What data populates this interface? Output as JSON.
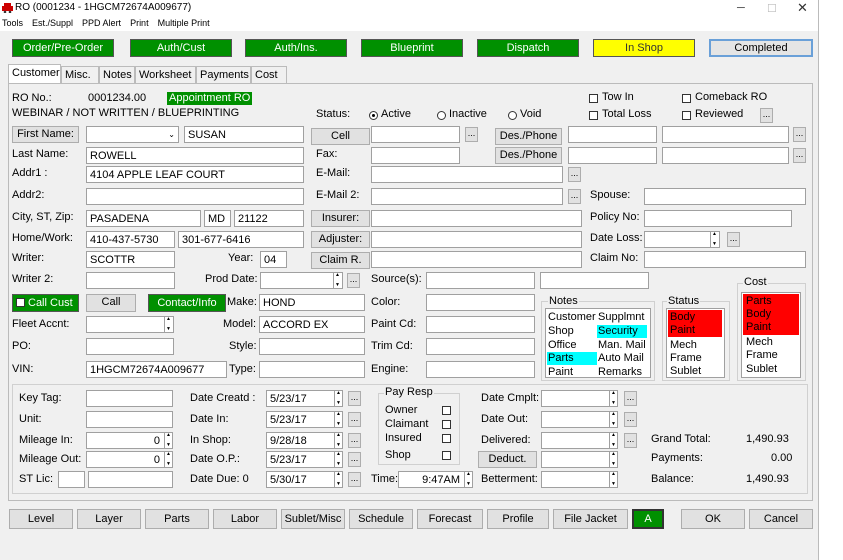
{
  "window": {
    "title": "RO (0001234 - 1HGCM72674A009677)"
  },
  "menu": [
    "Tools",
    "Est./Suppl",
    "PPD Alert",
    "Print",
    "Multiple Print"
  ],
  "top_buttons": [
    "Order/Pre-Order",
    "Auth/Cust",
    "Auth/Ins.",
    "Blueprint",
    "Dispatch",
    "In Shop",
    "Completed"
  ],
  "tabs": [
    "Customer",
    "Misc.",
    "Notes",
    "Worksheet",
    "Payments",
    "Cost"
  ],
  "ro": {
    "label": "RO No.:",
    "number": "0001234.00",
    "appointment": "Appointment RO",
    "subtitle": "WEBINAR / NOT WRITTEN / BLUEPRINTING"
  },
  "status": {
    "label": "Status:",
    "options": [
      "Active",
      "Inactive",
      "Void"
    ]
  },
  "flags": [
    "Tow In",
    "Total Loss",
    "Comeback RO",
    "Reviewed"
  ],
  "customer": {
    "first_name_btn": "First Name:",
    "first_name": "SUSAN",
    "last_name_label": "Last Name:",
    "last_name": "ROWELL",
    "addr1_label": "Addr1 :",
    "addr1": "4104 APPLE LEAF COURT",
    "addr2_label": "Addr2:",
    "addr2": "",
    "city_label": "City, ST, Zip:",
    "city": "PASADENA",
    "state": "MD",
    "zip": "21122",
    "home_work_label": "Home/Work:",
    "home": "410-437-5730",
    "work": "301-677-6416",
    "writer_label": "Writer:",
    "writer": "SCOTTR",
    "year_label": "Year:",
    "year": "04",
    "writer2_label": "Writer 2:",
    "prod_date_label": "Prod Date:"
  },
  "contact": {
    "cell_btn": "Cell",
    "fax_label": "Fax:",
    "email_label": "E-Mail:",
    "email2_label": "E-Mail 2:",
    "desphone_btn": "Des./Phone",
    "insurer_btn": "Insurer:",
    "adjuster_btn": "Adjuster:",
    "claim_btn": "Claim R.",
    "spouse_label": "Spouse:",
    "policy_label": "Policy No:",
    "date_loss_label": "Date Loss:",
    "claim_no_label": "Claim No:",
    "sources_label": "Source(s):"
  },
  "vehicle": {
    "call_cust": "Call Cust",
    "call": "Call",
    "contact_info": "Contact/Info",
    "make_label": "Make:",
    "make": "HOND",
    "model_label": "Model:",
    "model": "ACCORD EX",
    "style_label": "Style:",
    "type_label": "Type:",
    "color_label": "Color:",
    "paint_label": "Paint Cd:",
    "trim_label": "Trim Cd:",
    "engine_label": "Engine:",
    "fleet_label": "Fleet Accnt:",
    "po_label": "PO:",
    "vin_label": "VIN:",
    "vin": "1HGCM72674A009677"
  },
  "notes": {
    "title": "Notes",
    "col1": [
      "Customer",
      "Shop",
      "Office",
      "Parts",
      "Paint"
    ],
    "col2": [
      "Supplmnt",
      "Security",
      "Man. Mail",
      "Auto Mail",
      "Remarks"
    ]
  },
  "status_list": {
    "title": "Status",
    "items": [
      "Body",
      "Paint",
      "Mech",
      "Frame",
      "Sublet"
    ]
  },
  "cost_list": {
    "title": "Cost",
    "items": [
      "Parts",
      "Body",
      "Paint",
      "Mech",
      "Frame",
      "Sublet"
    ]
  },
  "bottom": {
    "key_tag_label": "Key Tag:",
    "unit_label": "Unit:",
    "mileage_in_label": "Mileage In:",
    "mileage_in": "0",
    "mileage_out_label": "Mileage Out:",
    "mileage_out": "0",
    "st_lic_label": "ST Lic:",
    "date_created_label": "Date Creatd :",
    "date_created": "5/23/17",
    "date_in_label": "Date In:",
    "date_in": "5/23/17",
    "in_shop_label": "In Shop:",
    "in_shop": "9/28/18",
    "date_op_label": "Date O.P.:",
    "date_op": "5/23/17",
    "date_due_label": "Date Due: 0",
    "date_due": "5/30/17",
    "time_label": "Time:",
    "time": "9:47AM",
    "pay_resp_title": "Pay Resp",
    "pay_resp": [
      "Owner",
      "Claimant",
      "Insured",
      "Shop"
    ],
    "date_cmplt_label": "Date Cmplt:",
    "date_out_label": "Date Out:",
    "delivered_label": "Delivered:",
    "deduct_btn": "Deduct.",
    "betterment_label": "Betterment:",
    "grand_total_label": "Grand Total:",
    "grand_total": "1,490.93",
    "payments_label": "Payments:",
    "payments": "0.00",
    "balance_label": "Balance:",
    "balance": "1,490.93"
  },
  "footer_buttons": [
    "Level",
    "Layer",
    "Parts",
    "Labor",
    "Sublet/Misc",
    "Schedule",
    "Forecast",
    "Profile",
    "File Jacket",
    "A",
    "OK",
    "Cancel"
  ],
  "colors": {
    "green": "#009000",
    "yellow": "#ffff00",
    "cyan": "#00ffff",
    "red": "#ff0000"
  }
}
